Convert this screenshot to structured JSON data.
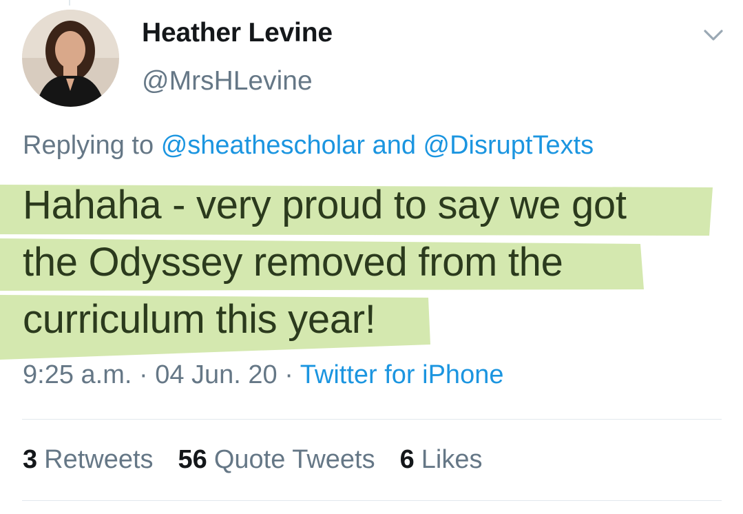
{
  "author": {
    "display_name": "Heather Levine",
    "handle": "@MrsHLevine"
  },
  "reply": {
    "prefix": "Replying to",
    "user1": "@sheathescholar",
    "conjunction": "and",
    "user2": "@DisruptTexts"
  },
  "tweet": {
    "line1": "Hahaha - very proud to say we got",
    "line2": "the Odyssey removed from the",
    "line3": "curriculum this year!"
  },
  "meta": {
    "time": "9:25 a.m.",
    "separator": "·",
    "date": "04 Jun. 20",
    "source": "Twitter for iPhone"
  },
  "stats": {
    "retweets_count": "3",
    "retweets_label": "Retweets",
    "quotes_count": "56",
    "quotes_label": "Quote Tweets",
    "likes_count": "6",
    "likes_label": "Likes"
  },
  "icons": {
    "menu": "chevron-down-icon"
  },
  "colors": {
    "link": "#1b95e0",
    "secondary_text": "#657786",
    "highlight": "#cfe6a6"
  }
}
